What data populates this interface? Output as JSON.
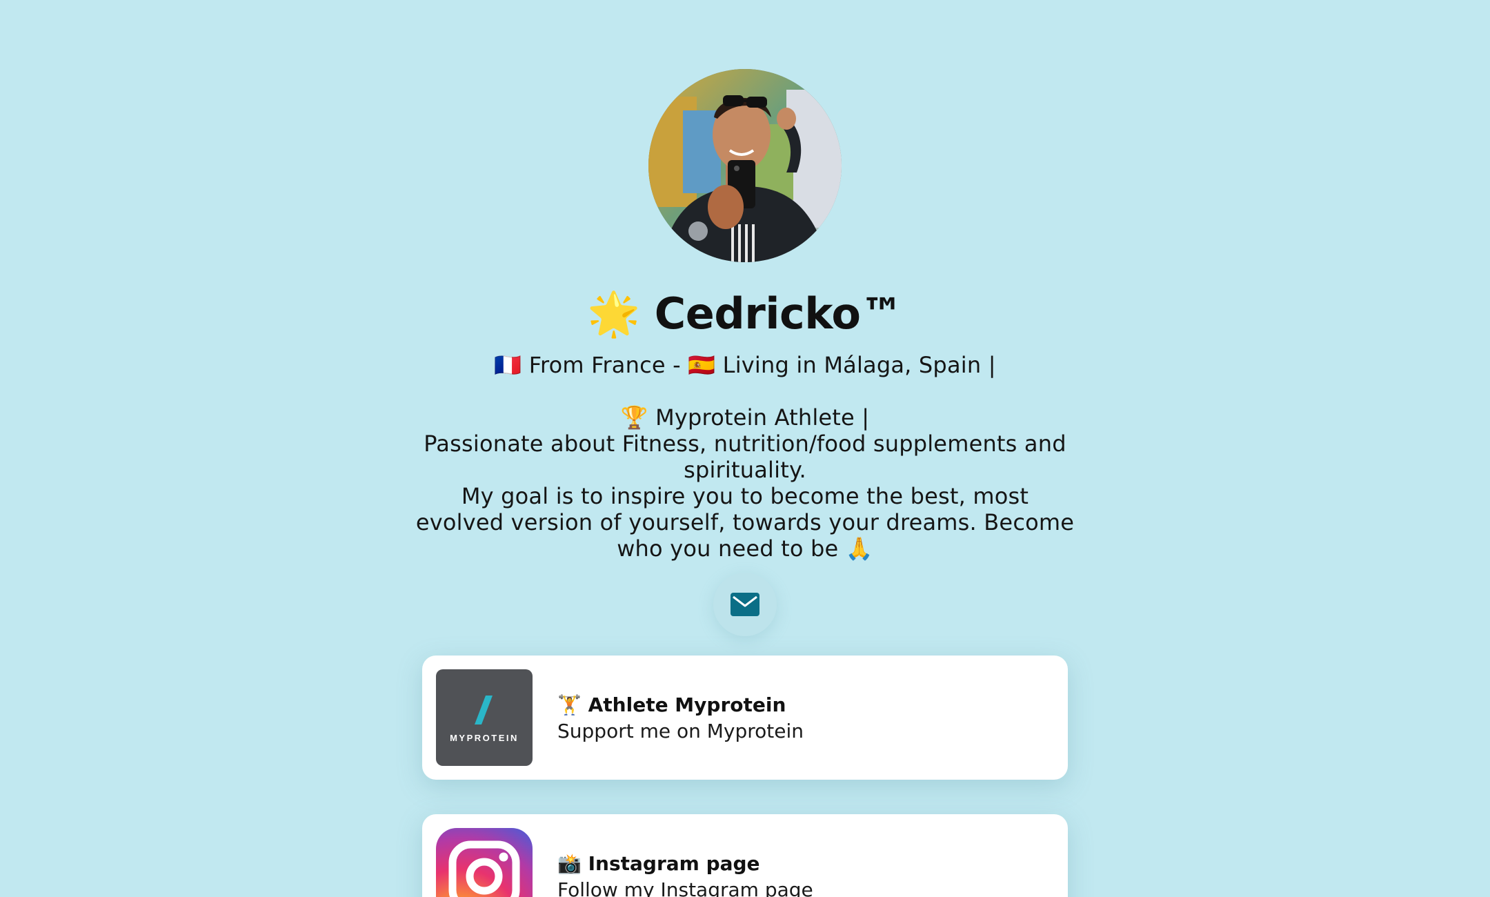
{
  "profile": {
    "name": "🌟 Cedricko™",
    "bio": "🇫🇷 From France - 🇪🇸 Living in Málaga, Spain |\n\n🏆 Myprotein Athlete |\nPassionate about Fitness, nutrition/food supplements and spirituality.\nMy goal is to inspire you to become the best, most evolved version of yourself, towards your dreams. Become who you need to be 🙏"
  },
  "contact": {
    "email_icon": "envelope-icon",
    "accent_color": "#0b6e86"
  },
  "links": [
    {
      "title": "🏋 Athlete Myprotein",
      "subtitle": "Support me on Myprotein",
      "thumbnail_icon": "myprotein-logo",
      "thumbnail_text": "MYPROTEIN"
    },
    {
      "title": "📸 Instagram page",
      "subtitle": "Follow my Instagram page",
      "thumbnail_icon": "instagram-logo"
    }
  ],
  "colors": {
    "background": "#c1e8f0",
    "card": "#ffffff",
    "myprotein_bg": "#505256",
    "myprotein_accent": "#2ab6c8"
  }
}
